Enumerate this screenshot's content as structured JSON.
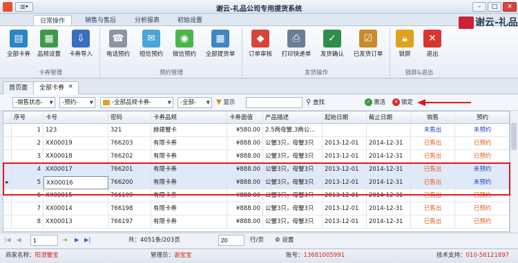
{
  "window": {
    "title": "谢云-礼品公司专用提货系统",
    "qa_label": "▥▾",
    "min": "–",
    "max": "□",
    "close": "✕"
  },
  "ribbon_tabs": [
    "日常操作",
    "销售与售后",
    "分析报表",
    "初始设置"
  ],
  "brand": "谢云-礼品",
  "groups": [
    {
      "label": "卡券管理",
      "buttons": [
        "全部卡券",
        "品规设置",
        "卡券导入"
      ]
    },
    {
      "label": "预约管理",
      "buttons": [
        "电话预约",
        "短信预约",
        "微信预约",
        "全部提货单"
      ]
    },
    {
      "label": "发货操作",
      "buttons": [
        "订单审核",
        "打印快递单",
        "发货确认",
        "已发货订单"
      ]
    },
    {
      "label": "锁屏&退出",
      "buttons": [
        "锁屏",
        "退出"
      ]
    }
  ],
  "doc_tabs": [
    "首页面",
    "全部卡券"
  ],
  "doc_tab_close": "✕",
  "filters": {
    "sale_status": "-销售状态-",
    "reserve": "-预约-",
    "spec": "-全部品规卡券-",
    "all": "-全部-",
    "show_label": "显示",
    "search_value": "",
    "search_label": "查找",
    "activate_label": "激活",
    "lock_label": "锁定"
  },
  "columns": [
    "序号",
    "卡号",
    "密码",
    "卡券品规",
    "卡券面值",
    "产品描述",
    "起始日期",
    "截止日期",
    "销售",
    "预约"
  ],
  "rows": [
    [
      "1",
      "123",
      "321",
      "赫建蟹卡",
      "¥580.00",
      "2.5两母蟹,3两公...",
      "",
      "",
      "未售出",
      "未预约"
    ],
    [
      "2",
      "XX00019",
      "766203",
      "有限卡券",
      "¥888.00",
      "公蟹3只，母蟹3只",
      "2013-12-01",
      "2014-12-31",
      "已售出",
      "已预约"
    ],
    [
      "3",
      "XX00018",
      "766202",
      "有限卡券",
      "¥888.00",
      "公蟹3只，母蟹3只",
      "2013-12-01",
      "2014-12-31",
      "已售出",
      "已预约"
    ],
    [
      "4",
      "XX00017",
      "766201",
      "有限卡券",
      "¥888.00",
      "公蟹3只，母蟹3只",
      "2013-12-01",
      "2014-12-31",
      "已售出",
      "未预约"
    ],
    [
      "5",
      "XX00016",
      "766200",
      "有限卡券",
      "¥888.00",
      "公蟹3只，母蟹3只",
      "2013-12-01",
      "2014-12-31",
      "已售出",
      "未预约"
    ],
    [
      "6",
      "XX00015",
      "766199",
      "有限卡券",
      "¥888.00",
      "公蟹3只，母蟹3只",
      "2013-12-01",
      "2014-12-31",
      "已售出",
      "已预约"
    ],
    [
      "7",
      "XX00014",
      "766198",
      "有限卡券",
      "¥888.00",
      "公蟹3只，母蟹3只",
      "2013-12-01",
      "2014-12-31",
      "已售出",
      "已预约"
    ],
    [
      "8",
      "XX00013",
      "766197",
      "有限卡券",
      "¥888.00",
      "公蟹3只，母蟹3只",
      "2013-12-01",
      "2014-12-31",
      "已售出",
      "已预约"
    ]
  ],
  "current_row_marker": "▸",
  "pager": {
    "page": "1",
    "total": "共：4051条/203页",
    "page_size": "20",
    "rows_per_page": "行/页",
    "settings": "设置"
  },
  "status": {
    "merchant_label": "商家名称：",
    "merchant": "阳澄蟹宝",
    "admin_label": "管理员：",
    "admin": "谢宝宝",
    "account_label": "账号：",
    "account": "13681005991",
    "support_label": "技术支持：",
    "support": "010-56121897"
  },
  "colors": {
    "unsold": "#1f3fc4",
    "sold": "#e05a1b",
    "highlight_box": "#e0141a"
  }
}
